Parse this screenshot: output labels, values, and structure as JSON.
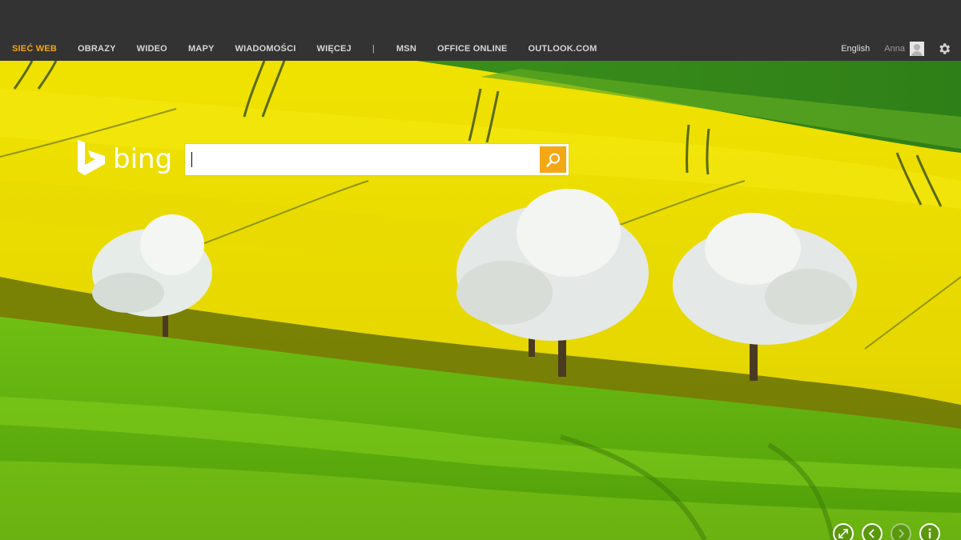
{
  "nav": {
    "items": [
      {
        "label": "SIEĆ WEB",
        "active": true
      },
      {
        "label": "OBRAZY"
      },
      {
        "label": "WIDEO"
      },
      {
        "label": "MAPY"
      },
      {
        "label": "WIADOMOŚCI"
      },
      {
        "label": "WIĘCEJ"
      }
    ],
    "separator": "|",
    "external": [
      {
        "label": "MSN"
      },
      {
        "label": "OFFICE ONLINE"
      },
      {
        "label": "OUTLOOK.COM"
      }
    ]
  },
  "header": {
    "language": "English",
    "user_name": "Anna"
  },
  "logo": {
    "text": "bing"
  },
  "search": {
    "value": "",
    "placeholder": ""
  },
  "colors": {
    "accent": "#f4a815",
    "topbar": "#333333",
    "nav_active": "#f2a516"
  },
  "icons": {
    "search": "search-icon",
    "settings": "gear-icon",
    "fullscreen": "expand-icon",
    "previous": "chevron-left-icon",
    "next": "chevron-right-icon",
    "info": "info-icon"
  },
  "controls": {
    "next_enabled": false
  }
}
